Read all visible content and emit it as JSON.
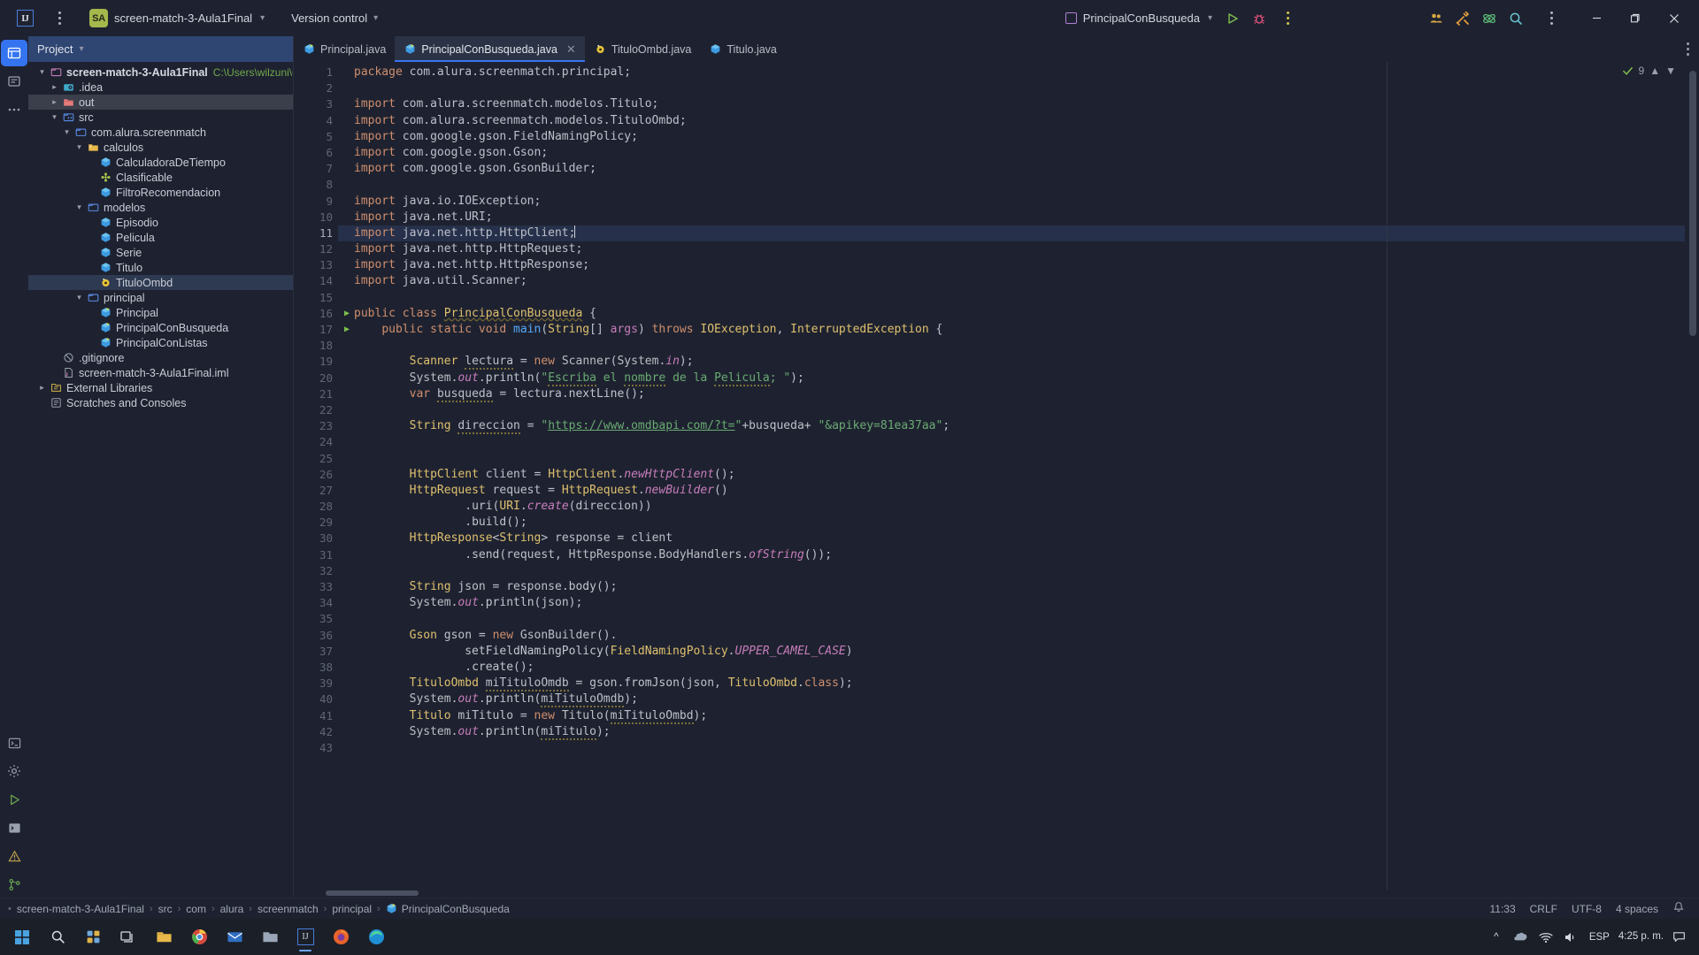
{
  "titlebar": {
    "logo_alt": "IntelliJ IDEA",
    "project_badge": "SA",
    "project_name": "screen-match-3-Aula1Final",
    "version_control": "Version control",
    "run_config": "PrincipalConBusqueda",
    "icons": [
      "kebab-menu-icon",
      "run-icon",
      "debug-icon",
      "more-actions-icon",
      "collaborate-icon",
      "tools-icon",
      "ai-assistant-icon",
      "search-icon",
      "options-icon"
    ],
    "window_controls": {
      "minimize": "─",
      "maximize": "❐",
      "close": "✕"
    }
  },
  "rail": {
    "items": [
      {
        "name": "project-tool-window",
        "glyph": "▤",
        "active": true
      },
      {
        "name": "commit-tool-window",
        "glyph": "≡",
        "active": false
      },
      {
        "name": "more-tool-windows",
        "glyph": "⋯",
        "active": false
      }
    ],
    "bottom_items": [
      {
        "name": "terminal-tool-window",
        "glyph": "▣"
      },
      {
        "name": "settings-tool-window",
        "glyph": "⚙"
      },
      {
        "name": "run-tool-window",
        "glyph": "▷"
      },
      {
        "name": "console-tool-window",
        "glyph": "⬛"
      },
      {
        "name": "problems-tool-window",
        "glyph": "⚠"
      },
      {
        "name": "version-control-tool-window",
        "glyph": "⎇"
      }
    ]
  },
  "project_panel": {
    "header": "Project",
    "tree": [
      {
        "depth": 0,
        "arrow": "down",
        "icon": "folder-module-icon",
        "label": "screen-match-3-Aula1Final",
        "bold": true,
        "path": "C:\\Users\\wilzuni\\OneDriv",
        "state": ""
      },
      {
        "depth": 1,
        "arrow": "right",
        "icon": "folder-idea-icon",
        "label": ".idea",
        "bold": false,
        "path": "",
        "state": ""
      },
      {
        "depth": 1,
        "arrow": "right",
        "icon": "folder-out-icon",
        "label": "out",
        "bold": false,
        "path": "",
        "state": "grey"
      },
      {
        "depth": 1,
        "arrow": "down",
        "icon": "folder-source-icon",
        "label": "src",
        "bold": false,
        "path": "",
        "state": ""
      },
      {
        "depth": 2,
        "arrow": "down",
        "icon": "package-icon",
        "label": "com.alura.screenmatch",
        "bold": false,
        "path": "",
        "state": ""
      },
      {
        "depth": 3,
        "arrow": "down",
        "icon": "folder-package-icon",
        "label": "calculos",
        "bold": false,
        "path": "",
        "state": ""
      },
      {
        "depth": 4,
        "arrow": "",
        "icon": "java-class-icon",
        "label": "CalculadoraDeTiempo",
        "bold": false,
        "path": "",
        "state": ""
      },
      {
        "depth": 4,
        "arrow": "",
        "icon": "java-interface-icon",
        "label": "Clasificable",
        "bold": false,
        "path": "",
        "state": ""
      },
      {
        "depth": 4,
        "arrow": "",
        "icon": "java-class-icon",
        "label": "FiltroRecomendacion",
        "bold": false,
        "path": "",
        "state": ""
      },
      {
        "depth": 3,
        "arrow": "down",
        "icon": "package-icon",
        "label": "modelos",
        "bold": false,
        "path": "",
        "state": ""
      },
      {
        "depth": 4,
        "arrow": "",
        "icon": "java-class-icon",
        "label": "Episodio",
        "bold": false,
        "path": "",
        "state": ""
      },
      {
        "depth": 4,
        "arrow": "",
        "icon": "java-class-icon",
        "label": "Pelicula",
        "bold": false,
        "path": "",
        "state": ""
      },
      {
        "depth": 4,
        "arrow": "",
        "icon": "java-class-icon",
        "label": "Serie",
        "bold": false,
        "path": "",
        "state": ""
      },
      {
        "depth": 4,
        "arrow": "",
        "icon": "java-class-icon",
        "label": "Titulo",
        "bold": false,
        "path": "",
        "state": ""
      },
      {
        "depth": 4,
        "arrow": "",
        "icon": "java-record-icon",
        "label": "TituloOmbd",
        "bold": false,
        "path": "",
        "state": "selected"
      },
      {
        "depth": 3,
        "arrow": "down",
        "icon": "package-icon",
        "label": "principal",
        "bold": false,
        "path": "",
        "state": ""
      },
      {
        "depth": 4,
        "arrow": "",
        "icon": "java-main-class-icon",
        "label": "Principal",
        "bold": false,
        "path": "",
        "state": ""
      },
      {
        "depth": 4,
        "arrow": "",
        "icon": "java-main-class-icon",
        "label": "PrincipalConBusqueda",
        "bold": false,
        "path": "",
        "state": ""
      },
      {
        "depth": 4,
        "arrow": "",
        "icon": "java-main-class-icon",
        "label": "PrincipalConListas",
        "bold": false,
        "path": "",
        "state": ""
      },
      {
        "depth": 1,
        "arrow": "",
        "icon": "gitignore-icon",
        "label": ".gitignore",
        "bold": false,
        "path": "",
        "state": ""
      },
      {
        "depth": 1,
        "arrow": "",
        "icon": "iml-file-icon",
        "label": "screen-match-3-Aula1Final.iml",
        "bold": false,
        "path": "",
        "state": ""
      },
      {
        "depth": 0,
        "arrow": "right",
        "icon": "external-libraries-icon",
        "label": "External Libraries",
        "bold": false,
        "path": "",
        "state": ""
      },
      {
        "depth": 0,
        "arrow": "",
        "icon": "scratches-icon",
        "label": "Scratches and Consoles",
        "bold": false,
        "path": "",
        "state": ""
      }
    ]
  },
  "tabs": [
    {
      "label": "Principal.java",
      "icon": "java-main-class-icon",
      "active": false,
      "closable": false
    },
    {
      "label": "PrincipalConBusqueda.java",
      "icon": "java-main-class-icon",
      "active": true,
      "closable": true
    },
    {
      "label": "TituloOmbd.java",
      "icon": "java-record-icon",
      "active": false,
      "closable": false
    },
    {
      "label": "Titulo.java",
      "icon": "java-class-icon",
      "active": false,
      "closable": false
    }
  ],
  "editor": {
    "inspection_count": "9",
    "first_line": 1,
    "current_line": 11,
    "run_markers": [
      16,
      17
    ],
    "lines": [
      {
        "n": 1,
        "html": "<span class=\"k\">package</span> com.alura.screenmatch.principal;"
      },
      {
        "n": 2,
        "html": ""
      },
      {
        "n": 3,
        "html": "<span class=\"k\">import</span> com.alura.screenmatch.modelos.Titulo;"
      },
      {
        "n": 4,
        "html": "<span class=\"k\">import</span> com.alura.screenmatch.modelos.TituloOmbd;"
      },
      {
        "n": 5,
        "html": "<span class=\"k\">import</span> com.google.gson.FieldNamingPolicy;"
      },
      {
        "n": 6,
        "html": "<span class=\"k\">import</span> com.google.gson.Gson;"
      },
      {
        "n": 7,
        "html": "<span class=\"k\">import</span> com.google.gson.GsonBuilder;"
      },
      {
        "n": 8,
        "html": ""
      },
      {
        "n": 9,
        "html": "<span class=\"k\">import</span> java.io.IOException;"
      },
      {
        "n": 10,
        "html": "<span class=\"k\">import</span> java.net.URI;"
      },
      {
        "n": 11,
        "html": "<span class=\"k\">import</span> java.net.http.HttpClient;<span class=\"caret\"></span>"
      },
      {
        "n": 12,
        "html": "<span class=\"k\">import</span> java.net.http.HttpRequest;"
      },
      {
        "n": 13,
        "html": "<span class=\"k\">import</span> java.net.http.HttpResponse;"
      },
      {
        "n": 14,
        "html": "<span class=\"k\">import</span> java.util.Scanner;"
      },
      {
        "n": 15,
        "html": ""
      },
      {
        "n": 16,
        "html": "<span class=\"k\">public class</span> <span class=\"ty err-sq\">PrincipalConBusqueda</span> {"
      },
      {
        "n": 17,
        "html": "    <span class=\"k\">public static</span> <span class=\"k\">void</span> <span class=\"fn\">main</span>(<span class=\"ty\">String</span>[] <span class=\"id\">args</span>) <span class=\"k\">throws</span> <span class=\"ty\">IOException</span>, <span class=\"ty\">InterruptedException</span> {"
      },
      {
        "n": 18,
        "html": ""
      },
      {
        "n": 19,
        "html": "        <span class=\"ty\">Scanner</span> <span class=\"sq\">lectura</span> = <span class=\"k\">new</span> <span class=\"cls\">Scanner</span>(<span class=\"cls\">System</span>.<span class=\"st\">in</span>);"
      },
      {
        "n": 20,
        "html": "        <span class=\"cls\">System</span>.<span class=\"st\">out</span>.<span class=\"fld\">println</span>(<span class=\"str\">\"<span class=\"sq\">Escriba</span> el <span class=\"sq\">nombre</span> de la <span class=\"sq\">Pelicula</span>; \"</span>);"
      },
      {
        "n": 21,
        "html": "        <span class=\"k\">var</span> <span class=\"sq\">busqueda</span> = lectura.<span class=\"fld\">nextLine</span>();"
      },
      {
        "n": 22,
        "html": ""
      },
      {
        "n": 23,
        "html": "        <span class=\"ty\">String</span> <span class=\"sq\">direccion</span> = <span class=\"str\">\"<span class=\"url\">https://www.omdbapi.com/?t=</span>\"</span>+busqueda+ <span class=\"str\">\"&amp;apikey=81ea37aa\"</span>;"
      },
      {
        "n": 24,
        "html": ""
      },
      {
        "n": 25,
        "html": ""
      },
      {
        "n": 26,
        "html": "        <span class=\"ty\">HttpClient</span> client = <span class=\"ty\">HttpClient</span>.<span class=\"st\">newHttpClient</span>();"
      },
      {
        "n": 27,
        "html": "        <span class=\"ty\">HttpRequest</span> request = <span class=\"ty\">HttpRequest</span>.<span class=\"st\">newBuilder</span>()"
      },
      {
        "n": 28,
        "html": "                .<span class=\"fld\">uri</span>(<span class=\"ty\">URI</span>.<span class=\"st\">create</span>(direccion))"
      },
      {
        "n": 29,
        "html": "                .<span class=\"fld\">build</span>();"
      },
      {
        "n": 30,
        "html": "        <span class=\"ty\">HttpResponse</span>&lt;<span class=\"ty\">String</span>&gt; response = client"
      },
      {
        "n": 31,
        "html": "                .<span class=\"fld\">send</span>(request, <span class=\"cls\">HttpResponse</span>.<span class=\"cls\">BodyHandlers</span>.<span class=\"st\">ofString</span>());"
      },
      {
        "n": 32,
        "html": ""
      },
      {
        "n": 33,
        "html": "        <span class=\"ty\">String</span> json = response.<span class=\"fld\">body</span>();"
      },
      {
        "n": 34,
        "html": "        <span class=\"cls\">System</span>.<span class=\"st\">out</span>.<span class=\"fld\">println</span>(json);"
      },
      {
        "n": 35,
        "html": ""
      },
      {
        "n": 36,
        "html": "        <span class=\"ty\">Gson</span> gson = <span class=\"k\">new</span> <span class=\"cls\">GsonBuilder</span>()."
      },
      {
        "n": 37,
        "html": "                <span class=\"fld\">setFieldNamingPolicy</span>(<span class=\"ty\">FieldNamingPolicy</span>.<span class=\"st\">UPPER_CAMEL_CASE</span>)"
      },
      {
        "n": 38,
        "html": "                .<span class=\"fld\">create</span>();"
      },
      {
        "n": 39,
        "html": "        <span class=\"ty\">TituloOmbd</span> <span class=\"sq\">miTituloOmdb</span> = gson.<span class=\"fld\">fromJson</span>(json, <span class=\"ty\">TituloOmbd</span>.<span class=\"k\">class</span>);"
      },
      {
        "n": 40,
        "html": "        <span class=\"cls\">System</span>.<span class=\"st\">out</span>.<span class=\"fld\">println</span>(<span class=\"sq\">miTituloOmdb</span>);"
      },
      {
        "n": 41,
        "html": "        <span class=\"ty\">Titulo</span> miTitulo = <span class=\"k\">new</span> <span class=\"cls\">Titulo</span>(<span class=\"sq\">miTituloOmbd</span>);"
      },
      {
        "n": 42,
        "html": "        <span class=\"cls\">System</span>.<span class=\"st\">out</span>.<span class=\"fld\">println</span>(<span class=\"sq\">miTitulo</span>);"
      },
      {
        "n": 43,
        "html": ""
      }
    ]
  },
  "statusbar": {
    "breadcrumbs": [
      {
        "label": "screen-match-3-Aula1Final",
        "icon": ""
      },
      {
        "label": "src",
        "icon": ""
      },
      {
        "label": "com",
        "icon": ""
      },
      {
        "label": "alura",
        "icon": ""
      },
      {
        "label": "screenmatch",
        "icon": ""
      },
      {
        "label": "principal",
        "icon": ""
      },
      {
        "label": "PrincipalConBusqueda",
        "icon": "java-main-class-icon"
      }
    ],
    "caret_position": "11:33",
    "line_separator": "CRLF",
    "encoding": "UTF-8",
    "indent": "4 spaces"
  },
  "taskbar": {
    "items": [
      {
        "name": "start-button",
        "glyph": "⊞"
      },
      {
        "name": "search-taskbar-icon",
        "glyph": "⌕"
      },
      {
        "name": "widgets-icon",
        "glyph": "▦"
      },
      {
        "name": "task-view-icon",
        "glyph": "❑"
      },
      {
        "name": "file-explorer-icon",
        "glyph": "▱"
      },
      {
        "name": "chrome-icon",
        "glyph": "◉"
      },
      {
        "name": "mail-icon",
        "glyph": "✉"
      },
      {
        "name": "folder-icon",
        "glyph": "▱"
      },
      {
        "name": "intellij-taskbar-icon",
        "glyph": "IJ"
      },
      {
        "name": "firefox-icon",
        "glyph": "●"
      },
      {
        "name": "edge-icon",
        "glyph": "○"
      }
    ],
    "tray": {
      "show-hidden-icons": "∧",
      "onedrive-icon": "☁",
      "network-icon": "὚7",
      "volume-icon": "🔊",
      "language": "ESP",
      "time": "4:25 p. m.",
      "date": "",
      "notifications-icon": "💬"
    }
  }
}
